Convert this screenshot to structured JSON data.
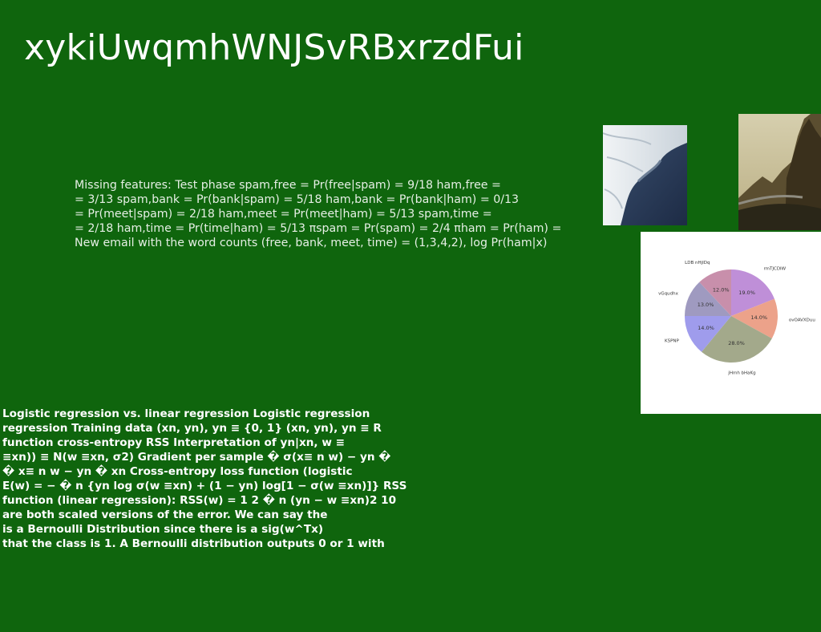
{
  "title": "xykiUwqmhWNJSvRBxrzdFui",
  "paragraph1": {
    "lines": [
      "Missing features: Test phase \u0003spam,free = Pr(free|spam) = 9/18 \u0003ham,free =",
      "= 3/13 \u0003spam,bank = Pr(bank|spam) = 5/18 \u0003ham,bank = Pr(bank|ham) = 0/13",
      "= Pr(meet|spam) = 2/18 \u0003ham,meet = Pr(meet|ham) = 5/13 \u0003spam,time =",
      "= 2/18 \u0003ham,time = Pr(time|ham) = 5/13 πspam = Pr(spam) = 2/4 πham = Pr(ham) =",
      "New email with the word counts (free, bank, meet, time) = (1,3,4,2), log Pr(ham|x) \u0003"
    ]
  },
  "paragraph2": {
    "lines": [
      "Logistic regression vs. linear regression Logistic regression",
      "regression Training data (xn, yn), yn ≡ {0, 1} (xn, yn), yn ≡ R",
      "function cross-entropy RSS Interpretation of yn|xn, w ≡",
      "≡xn)) ≡ N(w ≡xn, σ2) Gradient per sample � σ(x≡ n w) − yn �",
      "� x≡ n w − yn � xn Cross-entropy loss function (logistic",
      "E(w) = − � n {yn log σ(w ≡xn) + (1 − yn) log[1 − σ(w ≡xn)]} RSS",
      "function (linear regression): RSS(w) = 1 2 � n (yn − w ≡xn)2 10",
      "are both scaled versions of the error. We can say the",
      "is a Bernoulli Distribution since there is a sig(w^Tx)",
      "that the class is 1. A Bernoulli distribution outputs 0 or 1 with"
    ]
  },
  "images": {
    "wave_icon": "ocean-wave-photo",
    "mountain_icon": "mountain-road-photo"
  },
  "chart_data": {
    "type": "pie",
    "slices": [
      {
        "label": "rmTJCDIW",
        "value": 19.0,
        "pct": "19.0%",
        "color": "#bf8fd8"
      },
      {
        "label": "ovOAVXDuu",
        "value": 14.0,
        "pct": "14.0%",
        "color": "#eca28a"
      },
      {
        "label": "jHmh bHaKg",
        "value": 28.0,
        "pct": "28.0%",
        "color": "#a3a98b"
      },
      {
        "label": "KSPNP",
        "value": 14.0,
        "pct": "14.0%",
        "color": "#9f9cec"
      },
      {
        "label": "vGqudhx",
        "value": 13.0,
        "pct": "13.0%",
        "color": "#9f9ac0"
      },
      {
        "label": "LDB nHjIDq",
        "value": 12.0,
        "pct": "12.0%",
        "color": "#c88fab"
      }
    ]
  }
}
